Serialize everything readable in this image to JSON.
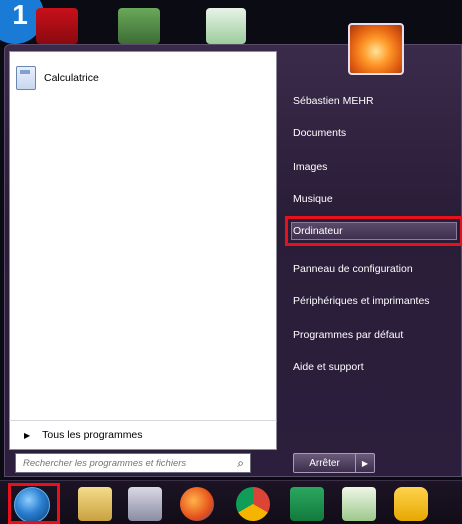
{
  "left_pane": {
    "pinned_program": "Calculatrice",
    "all_programs": "Tous les programmes",
    "search_placeholder": "Rechercher les programmes et fichiers"
  },
  "right_pane": {
    "items": [
      "Sébastien MEHR",
      "Documents",
      "Images",
      "Musique",
      "Ordinateur",
      "Panneau de configuration",
      "Périphériques et imprimantes",
      "Programmes par défaut",
      "Aide et support"
    ],
    "shutdown_label": "Arrêter",
    "shutdown_options_glyph": "▶"
  },
  "highlight_color": "#e8101a",
  "step_number": "1"
}
